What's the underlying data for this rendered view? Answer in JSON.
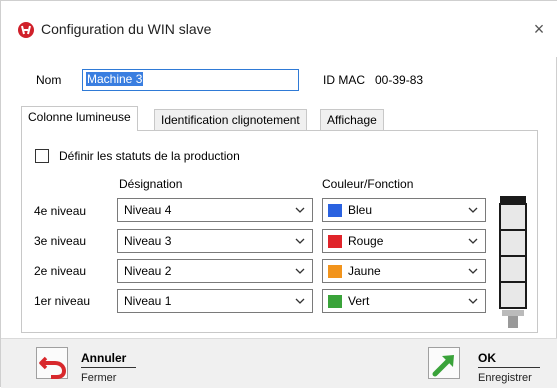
{
  "window": {
    "title": "Configuration du WIN slave",
    "close_label": "×"
  },
  "nom": {
    "label": "Nom",
    "value": "Machine 3"
  },
  "mac": {
    "label": "ID MAC",
    "value": "00-39-83"
  },
  "tabs": [
    {
      "label": "Colonne lumineuse",
      "active": true
    },
    {
      "label": "Identification clignotement",
      "active": false
    },
    {
      "label": "Affichage",
      "active": false
    }
  ],
  "checkbox": {
    "label": "Définir les statuts de la production",
    "checked": false
  },
  "headers": {
    "designation": "Désignation",
    "couleur": "Couleur/Fonction"
  },
  "rows": [
    {
      "level": "4e niveau",
      "designation": "Niveau 4",
      "color_name": "Bleu",
      "color": "#2a62e0"
    },
    {
      "level": "3e niveau",
      "designation": "Niveau 3",
      "color_name": "Rouge",
      "color": "#e0242a"
    },
    {
      "level": "2e niveau",
      "designation": "Niveau 2",
      "color_name": "Jaune",
      "color": "#f2941c"
    },
    {
      "level": "1er niveau",
      "designation": "Niveau 1",
      "color_name": "Vert",
      "color": "#3aa33a"
    }
  ],
  "footer": {
    "cancel": {
      "label": "Annuler",
      "sub": "Fermer",
      "icon": "undo-arrow-icon"
    },
    "ok": {
      "label": "OK",
      "sub": "Enregistrer",
      "icon": "green-arrow-icon"
    }
  },
  "colors": {
    "accent": "#3a7ee0",
    "app_icon_red": "#d0202a"
  }
}
